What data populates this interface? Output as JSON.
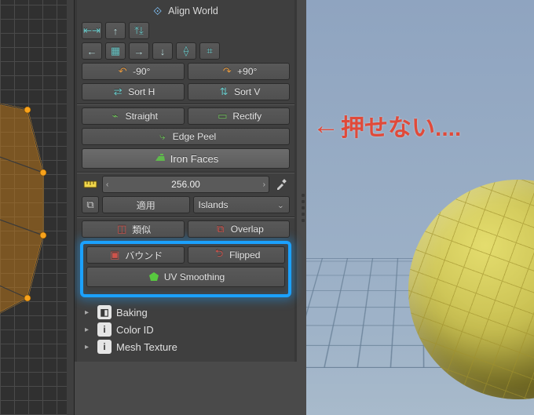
{
  "align": {
    "header": "Align World",
    "rot_neg": "-90°",
    "rot_pos": "+90°",
    "sort_h": "Sort H",
    "sort_v": "Sort V",
    "straight": "Straight",
    "rectify": "Rectify",
    "edge_peel": "Edge Peel",
    "iron_faces": "Iron Faces"
  },
  "size": {
    "value": "256.00",
    "apply_label": "適用",
    "mode": "Islands"
  },
  "checks": {
    "similar": "類似",
    "overlap": "Overlap",
    "bound": "バウンド",
    "flipped": "Flipped",
    "uv_smoothing": "UV Smoothing"
  },
  "tree": {
    "baking": "Baking",
    "color_id": "Color ID",
    "mesh_texture": "Mesh Texture"
  },
  "annotation": "押せない....",
  "icons": {
    "gizmo": "⟐",
    "arrow_left": "←",
    "arrow_right": "→",
    "arrow_up": "↑",
    "arrow_down": "↓",
    "rotate_ccw": "↶",
    "rotate_cw": "↷",
    "chevron_down": "⌄",
    "caret_right": "▸",
    "eyedropper": "✎"
  }
}
